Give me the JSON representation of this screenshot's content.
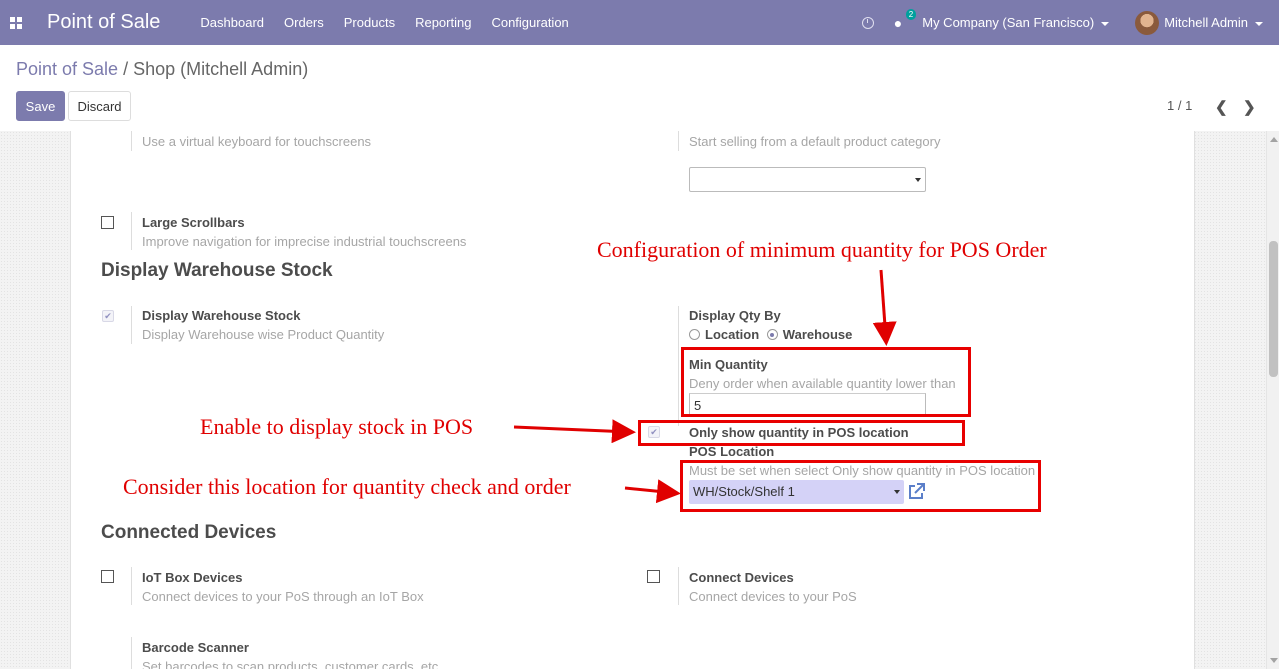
{
  "navbar": {
    "brand": "Point of Sale",
    "menu": [
      "Dashboard",
      "Orders",
      "Products",
      "Reporting",
      "Configuration"
    ],
    "chat_count": "2",
    "company": "My Company (San Francisco)",
    "user": "Mitchell Admin"
  },
  "breadcrumb": {
    "parent": "Point of Sale",
    "separator": "/",
    "current": "Shop (Mitchell Admin)"
  },
  "buttons": {
    "save": "Save",
    "discard": "Discard"
  },
  "pager": {
    "value": "1 / 1"
  },
  "settings": {
    "virtual_keyboard_desc": "Use a virtual keyboard for touchscreens",
    "default_category_desc": "Start selling from a default product category",
    "large_scrollbars": {
      "title": "Large Scrollbars",
      "desc": "Improve navigation for imprecise industrial touchscreens",
      "checked": false
    },
    "display_stock_section": "Display Warehouse Stock",
    "display_stock": {
      "title": "Display Warehouse Stock",
      "desc": "Display Warehouse wise Product Quantity",
      "checked": true
    },
    "qty_by": {
      "title": "Display Qty By",
      "option_location": "Location",
      "option_warehouse": "Warehouse",
      "selected": "Warehouse"
    },
    "min_qty": {
      "title": "Min Quantity",
      "desc": "Deny order when available quantity lower than",
      "value": "5"
    },
    "only_pos_location": {
      "title": "Only show quantity in POS location",
      "checked": true
    },
    "pos_location": {
      "title": "POS Location",
      "desc": "Must be set when select Only show quantity in POS location",
      "value": "WH/Stock/Shelf 1"
    },
    "connected_section": "Connected Devices",
    "iot": {
      "title": "IoT Box Devices",
      "desc": "Connect devices to your PoS through an IoT Box",
      "checked": false
    },
    "connect_devices": {
      "title": "Connect Devices",
      "desc": "Connect devices to your PoS",
      "checked": false
    },
    "barcode": {
      "title": "Barcode Scanner",
      "desc": "Set barcodes to scan products, customer cards, etc."
    }
  },
  "annotations": {
    "min_qty_note": "Configuration of minimum quantity  for POS Order",
    "enable_note": "Enable to display stock in POS",
    "location_note": "Consider this location for quantity check and order"
  },
  "colors": {
    "navbar": "#7c7bad",
    "primary": "#7c7bad",
    "annotation": "#e00000",
    "location_select_bg": "#d4d2f7"
  }
}
